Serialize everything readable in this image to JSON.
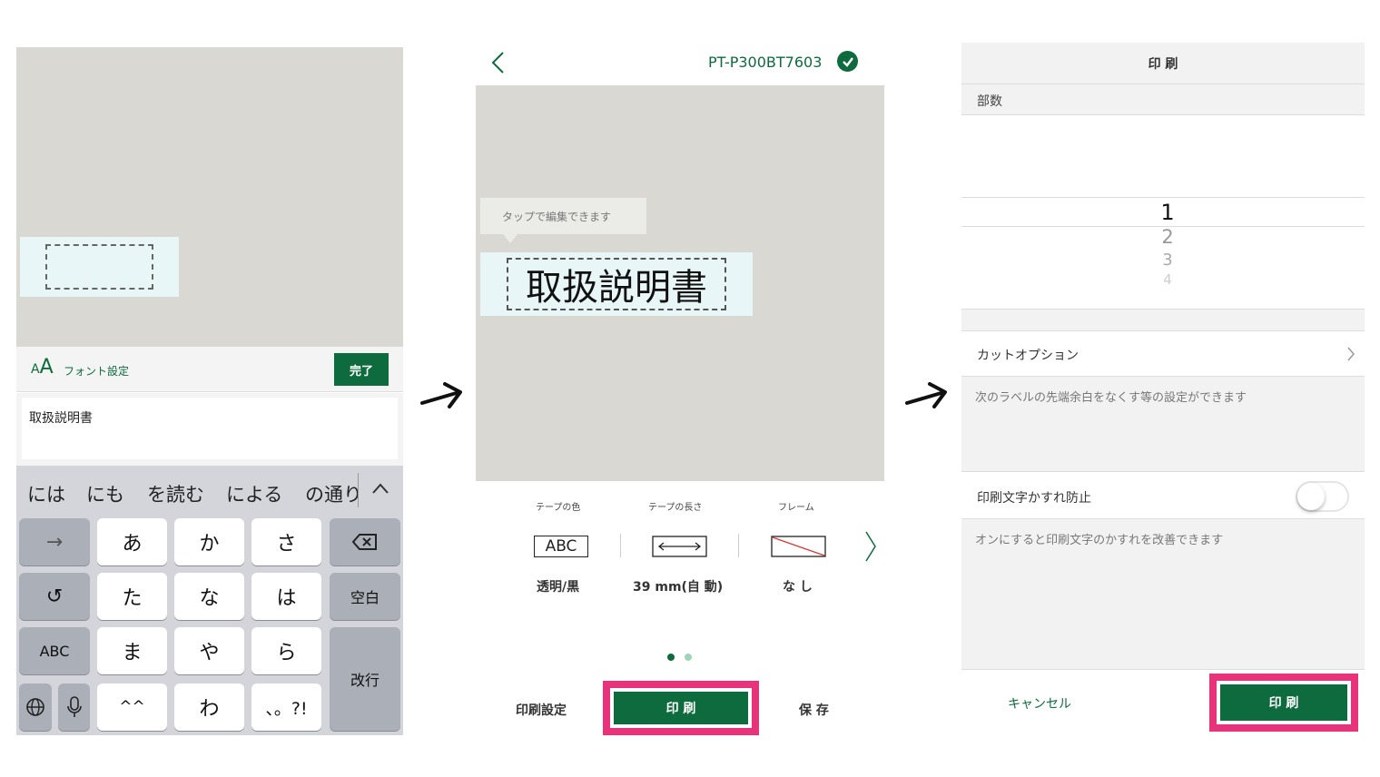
{
  "panel1": {
    "toolbar": {
      "font_setting": "フォント設定",
      "done": "完了"
    },
    "text_input": {
      "value": "取扱説明書"
    },
    "candidates": [
      "には",
      "にも",
      "を読む",
      "による",
      "の通り"
    ],
    "keys": {
      "arrow": "→",
      "a": "あ",
      "ka": "か",
      "sa": "さ",
      "undo": "↺",
      "ta": "た",
      "na": "な",
      "ha": "は",
      "space": "空白",
      "abc": "ABC",
      "ma": "ま",
      "ya": "や",
      "ra": "ら",
      "enter": "改行",
      "kaomoji": "^^",
      "wa": "わ",
      "punct": "、。?!"
    }
  },
  "panel2": {
    "header": {
      "device_name": "PT-P300BT7603"
    },
    "tooltip": "タップで編集できます",
    "label_text": "取扱説明書",
    "settings": [
      {
        "title": "テープの色",
        "icon_text": "ABC",
        "value": "透明/黒"
      },
      {
        "title": "テープの長さ",
        "value": "39 mm(自 動)"
      },
      {
        "title": "フレーム",
        "value": "な し"
      }
    ],
    "bottom": {
      "print_settings": "印刷設定",
      "print": "印 刷",
      "save": "保 存"
    }
  },
  "panel3": {
    "title": "印 刷",
    "copies_label": "部数",
    "picker": [
      "1",
      "2",
      "3",
      "4"
    ],
    "cut_option": "カットオプション",
    "cut_option_desc": "次のラベルの先端余白をなくす等の設定ができます",
    "blur_prevention": "印刷文字かすれ防止",
    "blur_prevention_desc": "オンにすると印刷文字のかすれを改善できます",
    "blur_prevention_on": false,
    "cancel": "キャンセル",
    "print": "印 刷"
  },
  "colors": {
    "accent_green": "#0e6b3e",
    "highlight_pink": "#e6337a"
  }
}
